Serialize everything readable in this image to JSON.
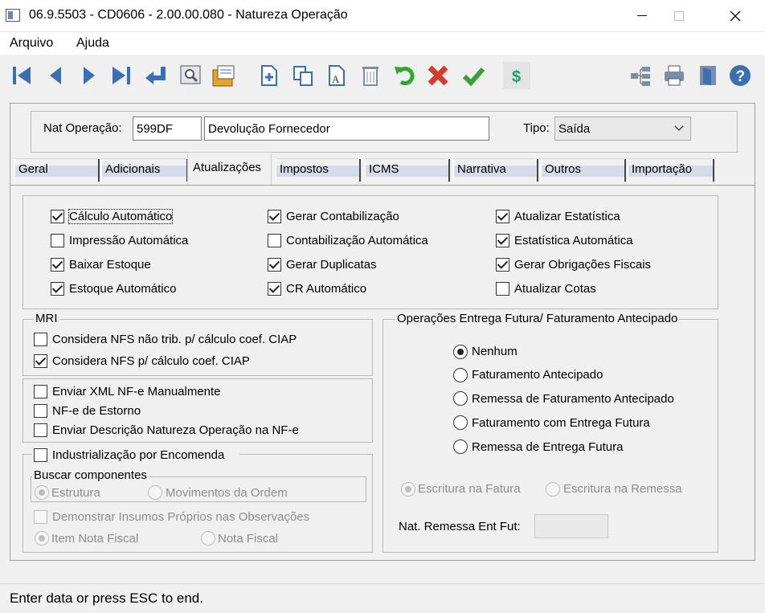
{
  "window": {
    "title": "06.9.5503 - CD0606 - 2.00.00.080 - Natureza Operação"
  },
  "menu": {
    "file": "Arquivo",
    "help": "Ajuda"
  },
  "header": {
    "nat_label": "Nat Operação:",
    "nat_code": "599DF",
    "nat_desc": "Devolução Fornecedor",
    "tipo_label": "Tipo:",
    "tipo_value": "Saída"
  },
  "tabs": [
    "Geral",
    "Adicionais",
    "Atualizações",
    "Impostos",
    "ICMS",
    "Narrativa",
    "Outros",
    "Importação"
  ],
  "updates": {
    "col1": [
      {
        "label": "Cálculo Automático",
        "checked": true
      },
      {
        "label": "Impressão Automática",
        "checked": false
      },
      {
        "label": "Baixar Estoque",
        "checked": true
      },
      {
        "label": "Estoque Automático",
        "checked": true
      }
    ],
    "col2": [
      {
        "label": "Gerar Contabilização",
        "checked": true
      },
      {
        "label": "Contabilização Automática",
        "checked": false
      },
      {
        "label": "Gerar Duplicatas",
        "checked": true
      },
      {
        "label": "CR Automático",
        "checked": true
      }
    ],
    "col3": [
      {
        "label": "Atualizar Estatística",
        "checked": true
      },
      {
        "label": "Estatística Automática",
        "checked": true
      },
      {
        "label": "Gerar Obrigações Fiscais",
        "checked": true
      },
      {
        "label": "Atualizar Cotas",
        "checked": false
      }
    ]
  },
  "mri": {
    "title": "MRI",
    "opt1": "Considera NFS não trib. p/ cálculo coef. CIAP",
    "opt2": "Considera NFS p/ cálculo coef. CIAP"
  },
  "nfe": {
    "opt1": "Enviar XML NF-e Manualmente",
    "opt2": "NF-e de Estorno",
    "opt3": "Enviar Descrição Natureza Operação na NF-e"
  },
  "indust": {
    "title": "Industrialização por Encomenda",
    "buscar": "Buscar componentes",
    "estrutura": "Estrutura",
    "movimentos": "Movimentos da Ordem",
    "demonstrar": "Demonstrar Insumos Próprios nas Observações",
    "item_nota": "Item Nota Fiscal",
    "nota": "Nota Fiscal"
  },
  "futura": {
    "title": "Operações Entrega Futura/ Faturamento Antecipado",
    "options": [
      "Nenhum",
      "Faturamento Antecipado",
      "Remessa de Faturamento Antecipado",
      "Faturamento com Entrega Futura",
      "Remessa de Entrega Futura"
    ],
    "escritura_fatura": "Escritura na Fatura",
    "escritura_remessa": "Escritura na Remessa",
    "nat_remessa_label": "Nat. Remessa Ent Fut:",
    "nat_remessa_value": ""
  },
  "status": {
    "text": "Enter data or press ESC to end."
  },
  "icons": [
    "first-icon",
    "previous-icon",
    "next-icon",
    "last-icon",
    "goto-icon",
    "search-icon",
    "zoom-icon",
    "add-icon",
    "copy-icon",
    "edit-icon",
    "delete-icon",
    "undo-icon",
    "cancel-icon",
    "save-icon",
    "dollar-icon",
    "tree-icon",
    "print-icon",
    "exit-icon",
    "help-icon"
  ],
  "colors": {
    "icon_blue": "#3a6fb4",
    "undo_green": "#2fa82f",
    "cancel_red": "#d33b2e",
    "ok_green": "#3aa13a"
  }
}
